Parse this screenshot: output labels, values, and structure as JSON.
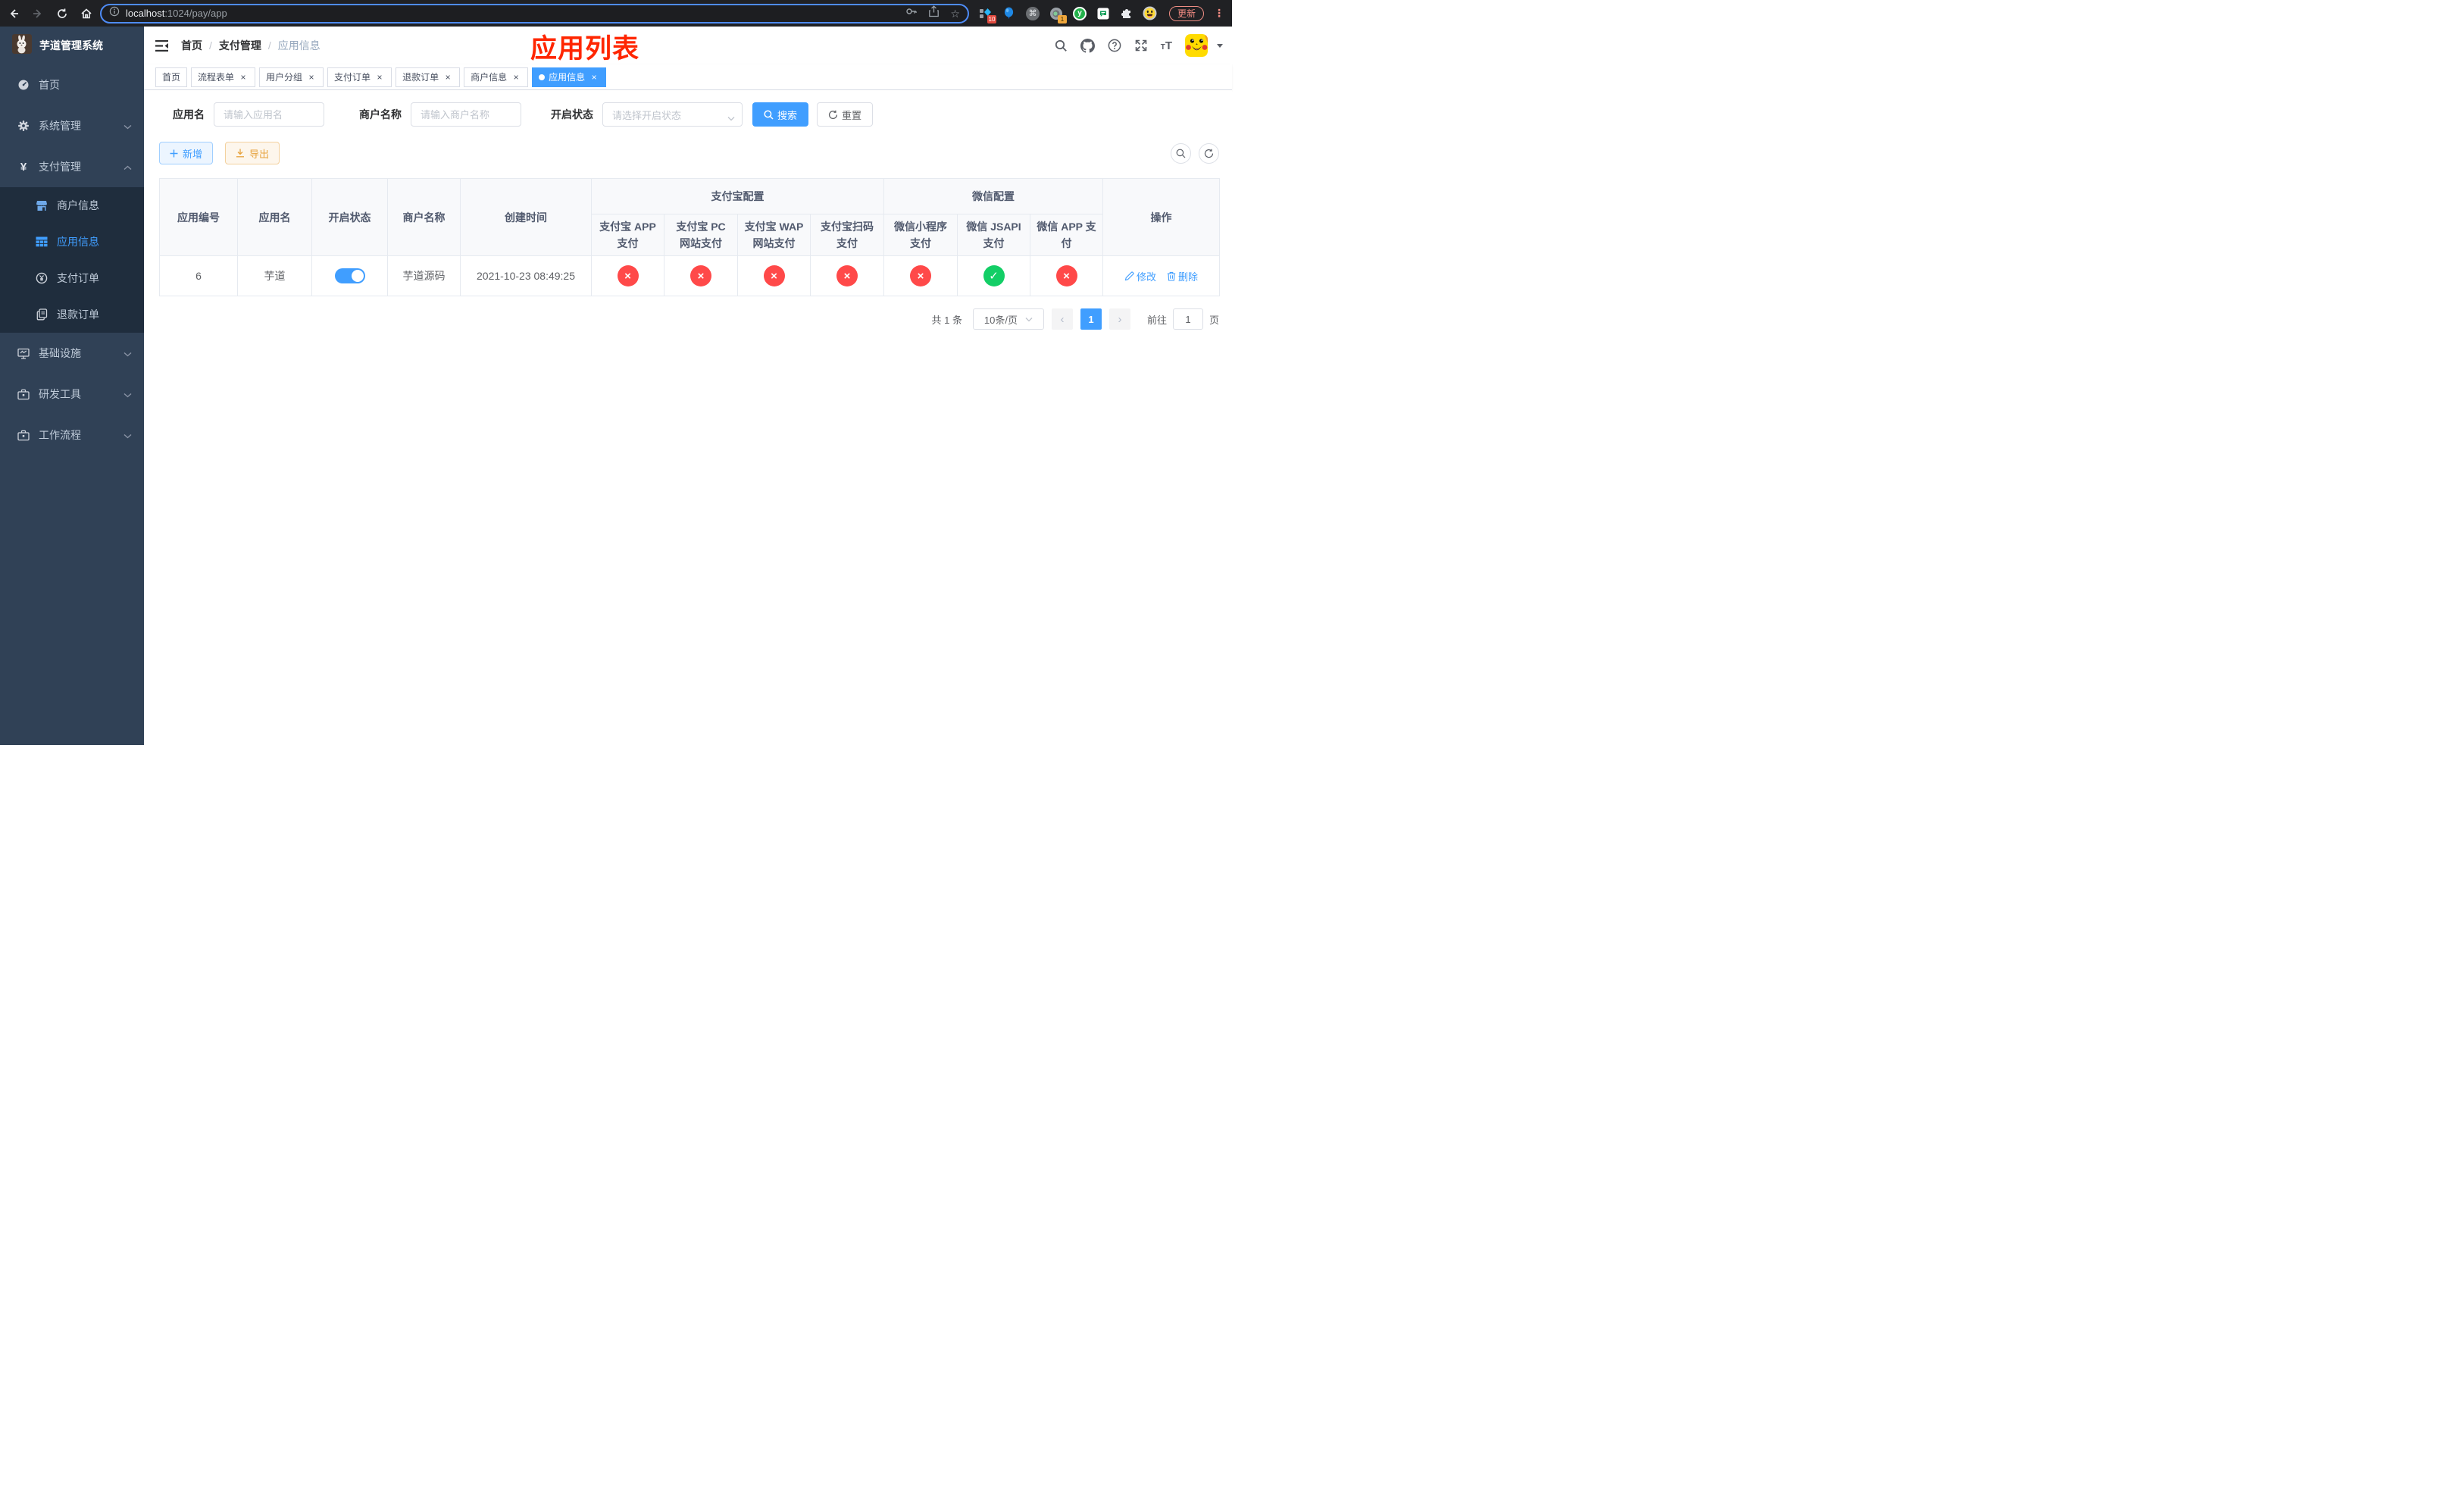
{
  "glyphs": {
    "close": "×",
    "check": "✓",
    "cross": "×",
    "sep": "/",
    "prev": "‹",
    "next": "›",
    "star": "☆",
    "cmd": "⌘",
    "ellipsis": "⋮",
    "yuan": "¥",
    "t_small": "T",
    "t_big": "T"
  },
  "browser": {
    "url_host": "localhost",
    "url_path": ":1024/pay/app",
    "update_label": "更新",
    "ext_badge_diamond": "10",
    "ext_badge_record": "1",
    "ext_y_letter": "y"
  },
  "sidebar": {
    "title": "芋道管理系统",
    "menu_top": [
      {
        "label": "首页"
      },
      {
        "label": "系统管理"
      },
      {
        "label": "支付管理"
      }
    ],
    "submenu": [
      {
        "label": "商户信息"
      },
      {
        "label": "应用信息"
      },
      {
        "label": "支付订单"
      },
      {
        "label": "退款订单"
      }
    ],
    "menu_bottom": [
      {
        "label": "基础设施"
      },
      {
        "label": "研发工具"
      },
      {
        "label": "工作流程"
      }
    ]
  },
  "navbar": {
    "breadcrumb": [
      "首页",
      "支付管理",
      "应用信息"
    ]
  },
  "annotation": "应用列表",
  "tabs": [
    {
      "label": "首页"
    },
    {
      "label": "流程表单"
    },
    {
      "label": "用户分组"
    },
    {
      "label": "支付订单"
    },
    {
      "label": "退款订单"
    },
    {
      "label": "商户信息"
    },
    {
      "label": "应用信息"
    }
  ],
  "filters": {
    "app_name_label": "应用名",
    "app_name_placeholder": "请输入应用名",
    "merchant_label": "商户名称",
    "merchant_placeholder": "请输入商户名称",
    "status_label": "开启状态",
    "status_placeholder": "请选择开启状态",
    "search_label": "搜索",
    "reset_label": "重置"
  },
  "toolbar": {
    "add_label": "新增",
    "export_label": "导出"
  },
  "table": {
    "group_alipay": "支付宝配置",
    "group_wechat": "微信配置",
    "columns": [
      "应用编号",
      "应用名",
      "开启状态",
      "商户名称",
      "创建时间",
      "支付宝 APP 支付",
      "支付宝 PC 网站支付",
      "支付宝 WAP 网站支付",
      "支付宝扫码支付",
      "微信小程序支付",
      "微信 JSAPI 支付",
      "微信 APP 支付",
      "操作"
    ],
    "row": {
      "id": "6",
      "name": "芋道",
      "enabled": true,
      "merchant": "芋道源码",
      "created": "2021-10-23 08:49:25",
      "statuses": [
        false,
        false,
        false,
        false,
        false,
        true,
        false
      ],
      "edit_label": "修改",
      "delete_label": "删除"
    }
  },
  "pagination": {
    "total": "共 1 条",
    "page_size": "10条/页",
    "page": "1",
    "goto_label": "前往",
    "goto_value": "1",
    "unit_label": "页"
  },
  "colors": {
    "primary": "#409eff",
    "danger": "#ff4949",
    "success": "#13ce66",
    "annotation": "#ff2600"
  }
}
